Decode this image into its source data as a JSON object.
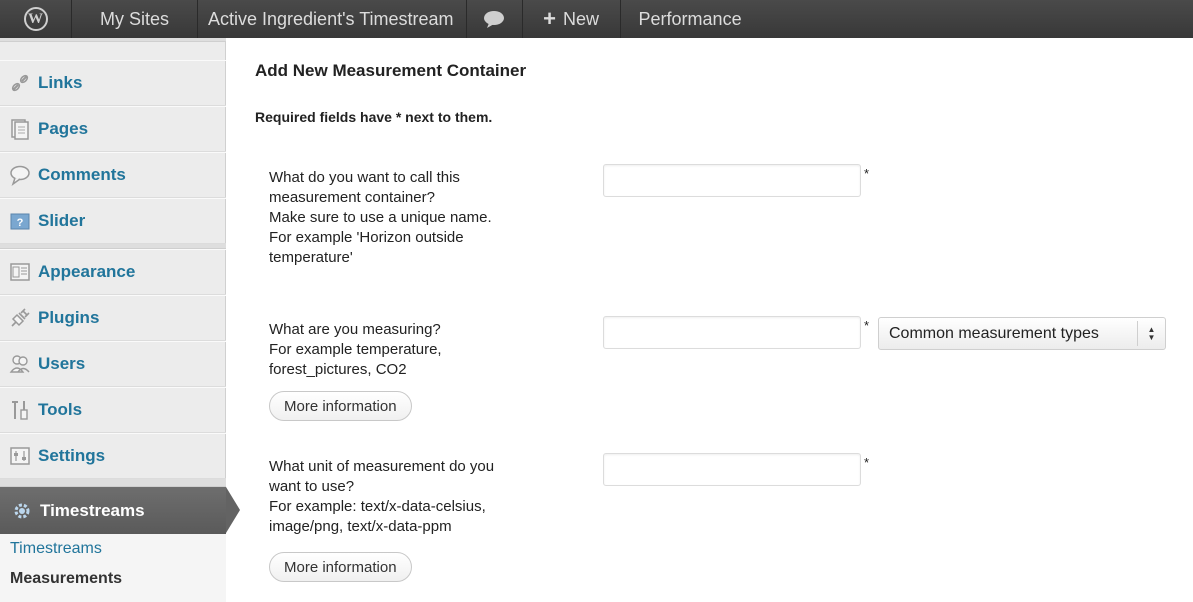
{
  "adminbar": {
    "my_sites": "My Sites",
    "site_name": "Active Ingredient's Timestream",
    "new_label": "New",
    "performance": "Performance",
    "icons": {
      "logo": "wordpress-logo-icon",
      "comments": "comment-bubble-icon",
      "new": "plus-icon"
    }
  },
  "sidebar": {
    "items": [
      {
        "label": "Links",
        "icon": "links-icon"
      },
      {
        "label": "Pages",
        "icon": "pages-icon"
      },
      {
        "label": "Comments",
        "icon": "comments-icon"
      },
      {
        "label": "Slider",
        "icon": "slider-icon"
      },
      {
        "label": "Appearance",
        "icon": "appearance-icon"
      },
      {
        "label": "Plugins",
        "icon": "plugins-icon"
      },
      {
        "label": "Users",
        "icon": "users-icon"
      },
      {
        "label": "Tools",
        "icon": "tools-icon"
      },
      {
        "label": "Settings",
        "icon": "settings-icon"
      }
    ],
    "current": {
      "label": "Timestreams",
      "icon": "gear-icon"
    },
    "submenu": [
      {
        "label": "Timestreams",
        "current": false
      },
      {
        "label": "Measurements",
        "current": true
      }
    ]
  },
  "main": {
    "title": "Add New Measurement Container",
    "required_note": "Required fields have * next to them.",
    "required_mark": "*",
    "fields": [
      {
        "question": [
          "What do you want to call this",
          "measurement container?",
          "Make sure to use a unique name.",
          "For example 'Horizon outside",
          "temperature'"
        ],
        "value": ""
      },
      {
        "question": [
          "What are you measuring?",
          "For example temperature,",
          "forest_pictures, CO2"
        ],
        "value": "",
        "more_info": "More information",
        "select_value": "Common measurement types"
      },
      {
        "question": [
          "What unit of measurement do you",
          "want to use?",
          "For example: text/x-data-celsius,",
          "image/png, text/x-data-ppm"
        ],
        "value": "",
        "more_info": "More information"
      }
    ]
  },
  "colors": {
    "link": "#21759b",
    "adminbar": "#464646",
    "sidebar": "#ececec",
    "current_menu": "#636363"
  }
}
